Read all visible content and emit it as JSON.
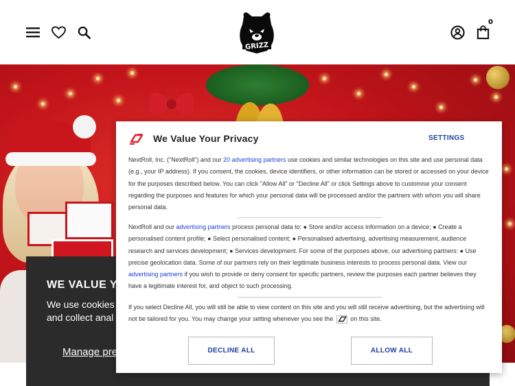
{
  "header": {
    "menu_icon": "menu-icon",
    "wishlist_icon": "heart-icon",
    "search_icon": "search-icon",
    "logo_text": "GRIZZ",
    "account_icon": "user-circle-icon",
    "cart_icon": "shopping-bag-icon",
    "cart_count": "0"
  },
  "site_cookie_banner": {
    "title": "WE VALUE YO",
    "text": "We use cookies and collect anal",
    "manage_link": "Manage pref"
  },
  "privacy_modal": {
    "title": "We Value Your Privacy",
    "settings_label": "SETTINGS",
    "para1_a": "NextRoll, Inc. (\"NextRoll\") and our ",
    "para1_link": "20 advertising partners",
    "para1_b": " use cookies and similar technologies on this site and use personal data (e.g., your IP address). If you consent, the cookies, device identifiers, or other information can be stored or accessed on your device for the purposes described below. You can click \"Allow All\" or \"Decline All\" or click Settings above to customise your consent regarding the purposes and features for which your personal data will be processed and/or the partners with whom you will share personal data.",
    "para2_a": "NextRoll and our ",
    "para2_link1": "advertising partners",
    "para2_b": " process personal data to: ● Store and/or access information on a device; ● Create a personalised content profile; ● Select personalised content; ● Personalised advertising, advertising measurement, audience research and services development; ● Services development. For some of the purposes above, our advertising partners: ● Use precise geolocation data. Some of our partners rely on their legitimate business interests to process personal data. View our ",
    "para2_link2": "advertising partners",
    "para2_c": " if you wish to provide or deny consent for specific partners, review the purposes each partner believes they have a legitimate interest for, and object to such processing.",
    "para3_a": "If you select Decline All, you will still be able to view content on this site and you will still receive advertising, but the advertising will not be tailored for you. You may change your setting whenever you see the ",
    "para3_b": " on this site.",
    "decline_label": "DECLINE ALL",
    "allow_label": "ALLOW ALL",
    "brand_color": "#e3262f",
    "link_color": "#1a3fd6"
  }
}
